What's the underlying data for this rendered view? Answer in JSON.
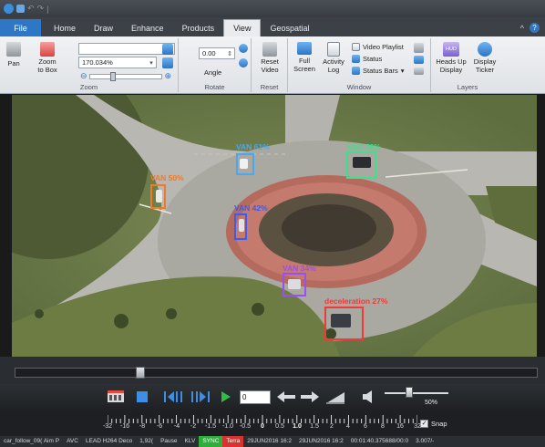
{
  "title_bar": {
    "separator": "|"
  },
  "tabs": [
    {
      "label": "File",
      "kind": "file"
    },
    {
      "label": "Home",
      "kind": "normal"
    },
    {
      "label": "Draw",
      "kind": "normal"
    },
    {
      "label": "Enhance",
      "kind": "normal"
    },
    {
      "label": "Products",
      "kind": "normal"
    },
    {
      "label": "View",
      "kind": "active"
    },
    {
      "label": "Geospatial",
      "kind": "normal"
    }
  ],
  "tab_right": {
    "caret": "^",
    "help": "?"
  },
  "ribbon": {
    "zoom_group": {
      "pan_label": "Pan",
      "zoom_to_box_label": "Zoom\nto Box",
      "zoom_combo_value": "170.034%",
      "group_label": "Zoom"
    },
    "rotate_group": {
      "angle_value": "0.00",
      "angle_label": "Angle",
      "group_label": "Rotate"
    },
    "reset_group": {
      "reset_video_label": "Reset\nVideo",
      "group_label": "Reset"
    },
    "window_group": {
      "full_screen_label": "Full\nScreen",
      "activity_log_label": "Activity\nLog",
      "video_playlist_label": "Video Playlist",
      "status_label": "Status",
      "status_bars_label": "Status Bars",
      "group_label": "Window"
    },
    "layers_group": {
      "hud_icon_text": "HUD",
      "heads_up_label": "Heads Up\nDisplay",
      "display_ticker_label": "Display\nTicker",
      "group_label": "Layers"
    }
  },
  "detections": [
    {
      "label": "VAN 50%",
      "color": "#f07a2a"
    },
    {
      "label": "VAN 61%",
      "color": "#4aa8f0"
    },
    {
      "label": "VAN 76%",
      "color": "#3fe08a"
    },
    {
      "label": "VAN 42%",
      "color": "#3a5cf0"
    },
    {
      "label": "VAN 34%",
      "color": "#9b4ff0"
    },
    {
      "label": "deceleration 27%",
      "color": "#f03a3a"
    }
  ],
  "player": {
    "frame_value": "0",
    "volume_label": "50%",
    "volume_level_percent": 50,
    "seek_position_percent": 23
  },
  "speed_ruler": {
    "labels": [
      "-32",
      "-16",
      "-8",
      "-6",
      "-4",
      "-2",
      "-1.5",
      "-1.0",
      "-0.5",
      "0",
      "0.5",
      "1.0",
      "1.5",
      "2",
      "4",
      "6",
      "8",
      "16",
      "32"
    ],
    "bold_labels": [
      "0",
      "1.0"
    ],
    "snap_label": "Snap",
    "snap_checked": "✓"
  },
  "status_bar": {
    "items": [
      {
        "text": "car_follow_09( Aim P",
        "kind": "plain"
      },
      {
        "text": "AVC",
        "kind": "plain"
      },
      {
        "text": "LEAD H264 Deco",
        "kind": "plain"
      },
      {
        "text": "1,92(",
        "kind": "plain"
      },
      {
        "text": "Pause",
        "kind": "plain"
      },
      {
        "text": "KLV",
        "kind": "plain"
      },
      {
        "text": "SYNC",
        "kind": "sync"
      },
      {
        "text": "Terra",
        "kind": "terra"
      },
      {
        "text": "29JUN2016 16:2",
        "kind": "plain"
      },
      {
        "text": "29JUN2016 16:2",
        "kind": "plain"
      },
      {
        "text": "00:01:40.375688/00:0",
        "kind": "plain"
      },
      {
        "text": "3.007/-",
        "kind": "plain"
      }
    ]
  }
}
